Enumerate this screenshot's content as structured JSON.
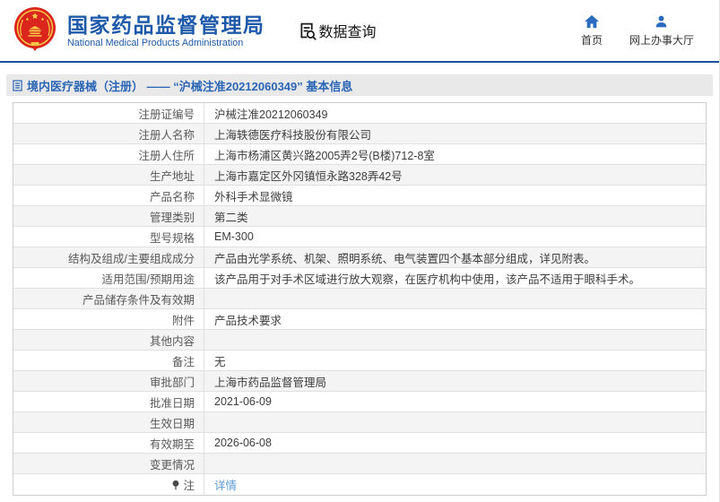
{
  "header": {
    "org_name_cn": "国家药品监督管理局",
    "org_name_en": "National Medical Products Administration",
    "data_query_label": "数据查询",
    "nav": [
      {
        "label": "首页",
        "icon": "home-icon"
      },
      {
        "label": "网上办事大厅",
        "icon": "user-icon"
      }
    ]
  },
  "breadcrumb": {
    "text": "境内医疗器械（注册） —— “沪械注准20212060349” 基本信息"
  },
  "table": {
    "rows": [
      {
        "label": "注册证编号",
        "value": "沪械注准20212060349"
      },
      {
        "label": "注册人名称",
        "value": "上海轶德医疗科技股份有限公司"
      },
      {
        "label": "注册人住所",
        "value": "上海市杨浦区黄兴路2005弄2号(B楼)712-8室"
      },
      {
        "label": "生产地址",
        "value": "上海市嘉定区外冈镇恒永路328弄42号"
      },
      {
        "label": "产品名称",
        "value": "外科手术显微镜"
      },
      {
        "label": "管理类别",
        "value": "第二类"
      },
      {
        "label": "型号规格",
        "value": "EM-300"
      },
      {
        "label": "结构及组成/主要组成成分",
        "value": "产品由光学系统、机架、照明系统、电气装置四个基本部分组成，详见附表。"
      },
      {
        "label": "适用范围/预期用途",
        "value": "该产品用于对手术区域进行放大观察，在医疗机构中使用，该产品不适用于眼科手术。"
      },
      {
        "label": "产品储存条件及有效期",
        "value": ""
      },
      {
        "label": "附件",
        "value": "产品技术要求"
      },
      {
        "label": "其他内容",
        "value": ""
      },
      {
        "label": "备注",
        "value": "无"
      },
      {
        "label": "审批部门",
        "value": "上海市药品监督管理局"
      },
      {
        "label": "批准日期",
        "value": "2021-06-09"
      },
      {
        "label": "生效日期",
        "value": ""
      },
      {
        "label": "有效期至",
        "value": "2026-06-08"
      },
      {
        "label": "变更情况",
        "value": ""
      },
      {
        "label": "注",
        "value": "详情",
        "value_is_link": true,
        "label_icon": "pin-icon"
      }
    ]
  },
  "colors": {
    "brand_blue": "#1e5aa9",
    "icon_blue": "#2a6bc0",
    "divider_blue": "#1c4f9e",
    "breadcrumb_bg": "#e9e9e9",
    "breadcrumb_text": "#2b65b5",
    "row_alt_bg": "#f4f4f4",
    "table_border": "#cfcfcf",
    "link_blue": "#5b9bd5",
    "emblem_red": "#da251c",
    "emblem_gold": "#f7c948"
  }
}
